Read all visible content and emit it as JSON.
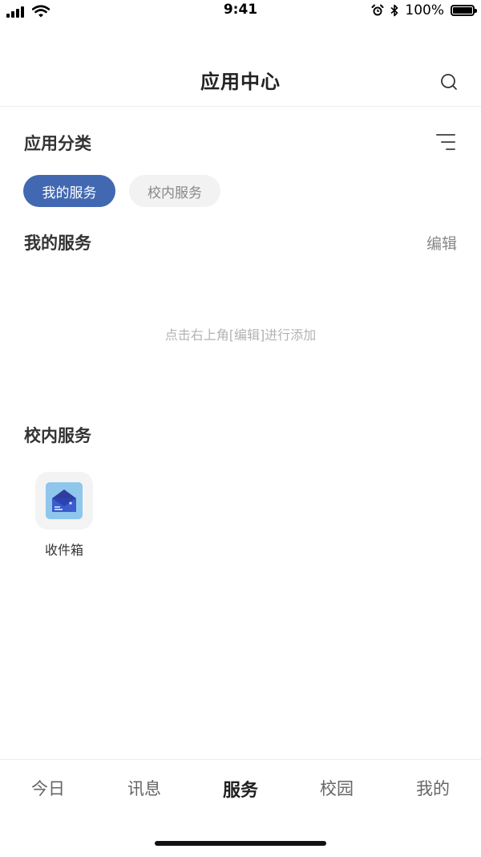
{
  "status_bar": {
    "time": "9:41",
    "battery": "100%"
  },
  "header": {
    "title": "应用中心",
    "search_icon": "search-icon"
  },
  "category": {
    "title": "应用分类",
    "menu_icon": "filter-lines-icon"
  },
  "chips": [
    {
      "label": "我的服务",
      "active": true
    },
    {
      "label": "校内服务",
      "active": false
    }
  ],
  "my_services": {
    "title": "我的服务",
    "edit_label": "编辑",
    "empty_hint": "点击右上角[编辑]进行添加"
  },
  "campus_services": {
    "title": "校内服务",
    "apps": [
      {
        "label": "收件箱",
        "icon": "inbox-envelope-icon"
      }
    ]
  },
  "tab_bar": {
    "tabs": [
      {
        "label": "今日",
        "active": false
      },
      {
        "label": "讯息",
        "active": false
      },
      {
        "label": "服务",
        "active": true
      },
      {
        "label": "校园",
        "active": false
      },
      {
        "label": "我的",
        "active": false
      }
    ]
  },
  "colors": {
    "accent": "#4268b2",
    "chip_inactive_bg": "#f2f2f2",
    "hint_text": "#b3b3b3"
  }
}
